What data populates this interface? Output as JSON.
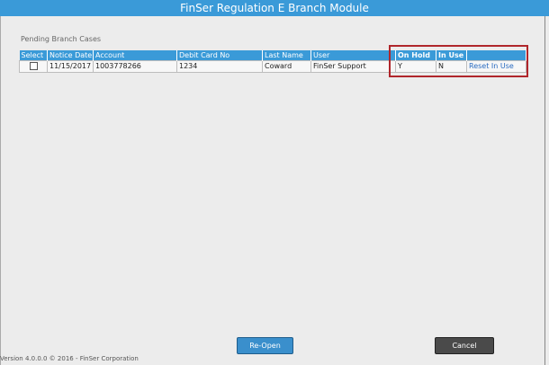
{
  "window": {
    "title": "FinSer Regulation E Branch Module"
  },
  "section": {
    "label": "Pending Branch Cases"
  },
  "table": {
    "headers": {
      "select": "Select",
      "notice_date": "Notice Date",
      "account": "Account",
      "debit_card": "Debit Card No",
      "last_name": "Last Name",
      "user": "User",
      "on_hold": "On Hold",
      "in_use": "In Use"
    },
    "rows": [
      {
        "notice_date": "11/15/2017",
        "account": "1003778266",
        "debit_card": "1234",
        "last_name": "Coward",
        "user": "FinSer Support",
        "on_hold": "Y",
        "in_use": "N",
        "action": "Reset In Use"
      }
    ]
  },
  "buttons": {
    "reopen": "Re-Open",
    "cancel": "Cancel"
  },
  "footer": {
    "text": "Version 4.0.0.0 © 2016 - FinSer Corporation"
  },
  "colors": {
    "header_blue": "#3a9ad8",
    "highlight_red": "#b0262b",
    "cancel_gray": "#4a4a4a"
  }
}
